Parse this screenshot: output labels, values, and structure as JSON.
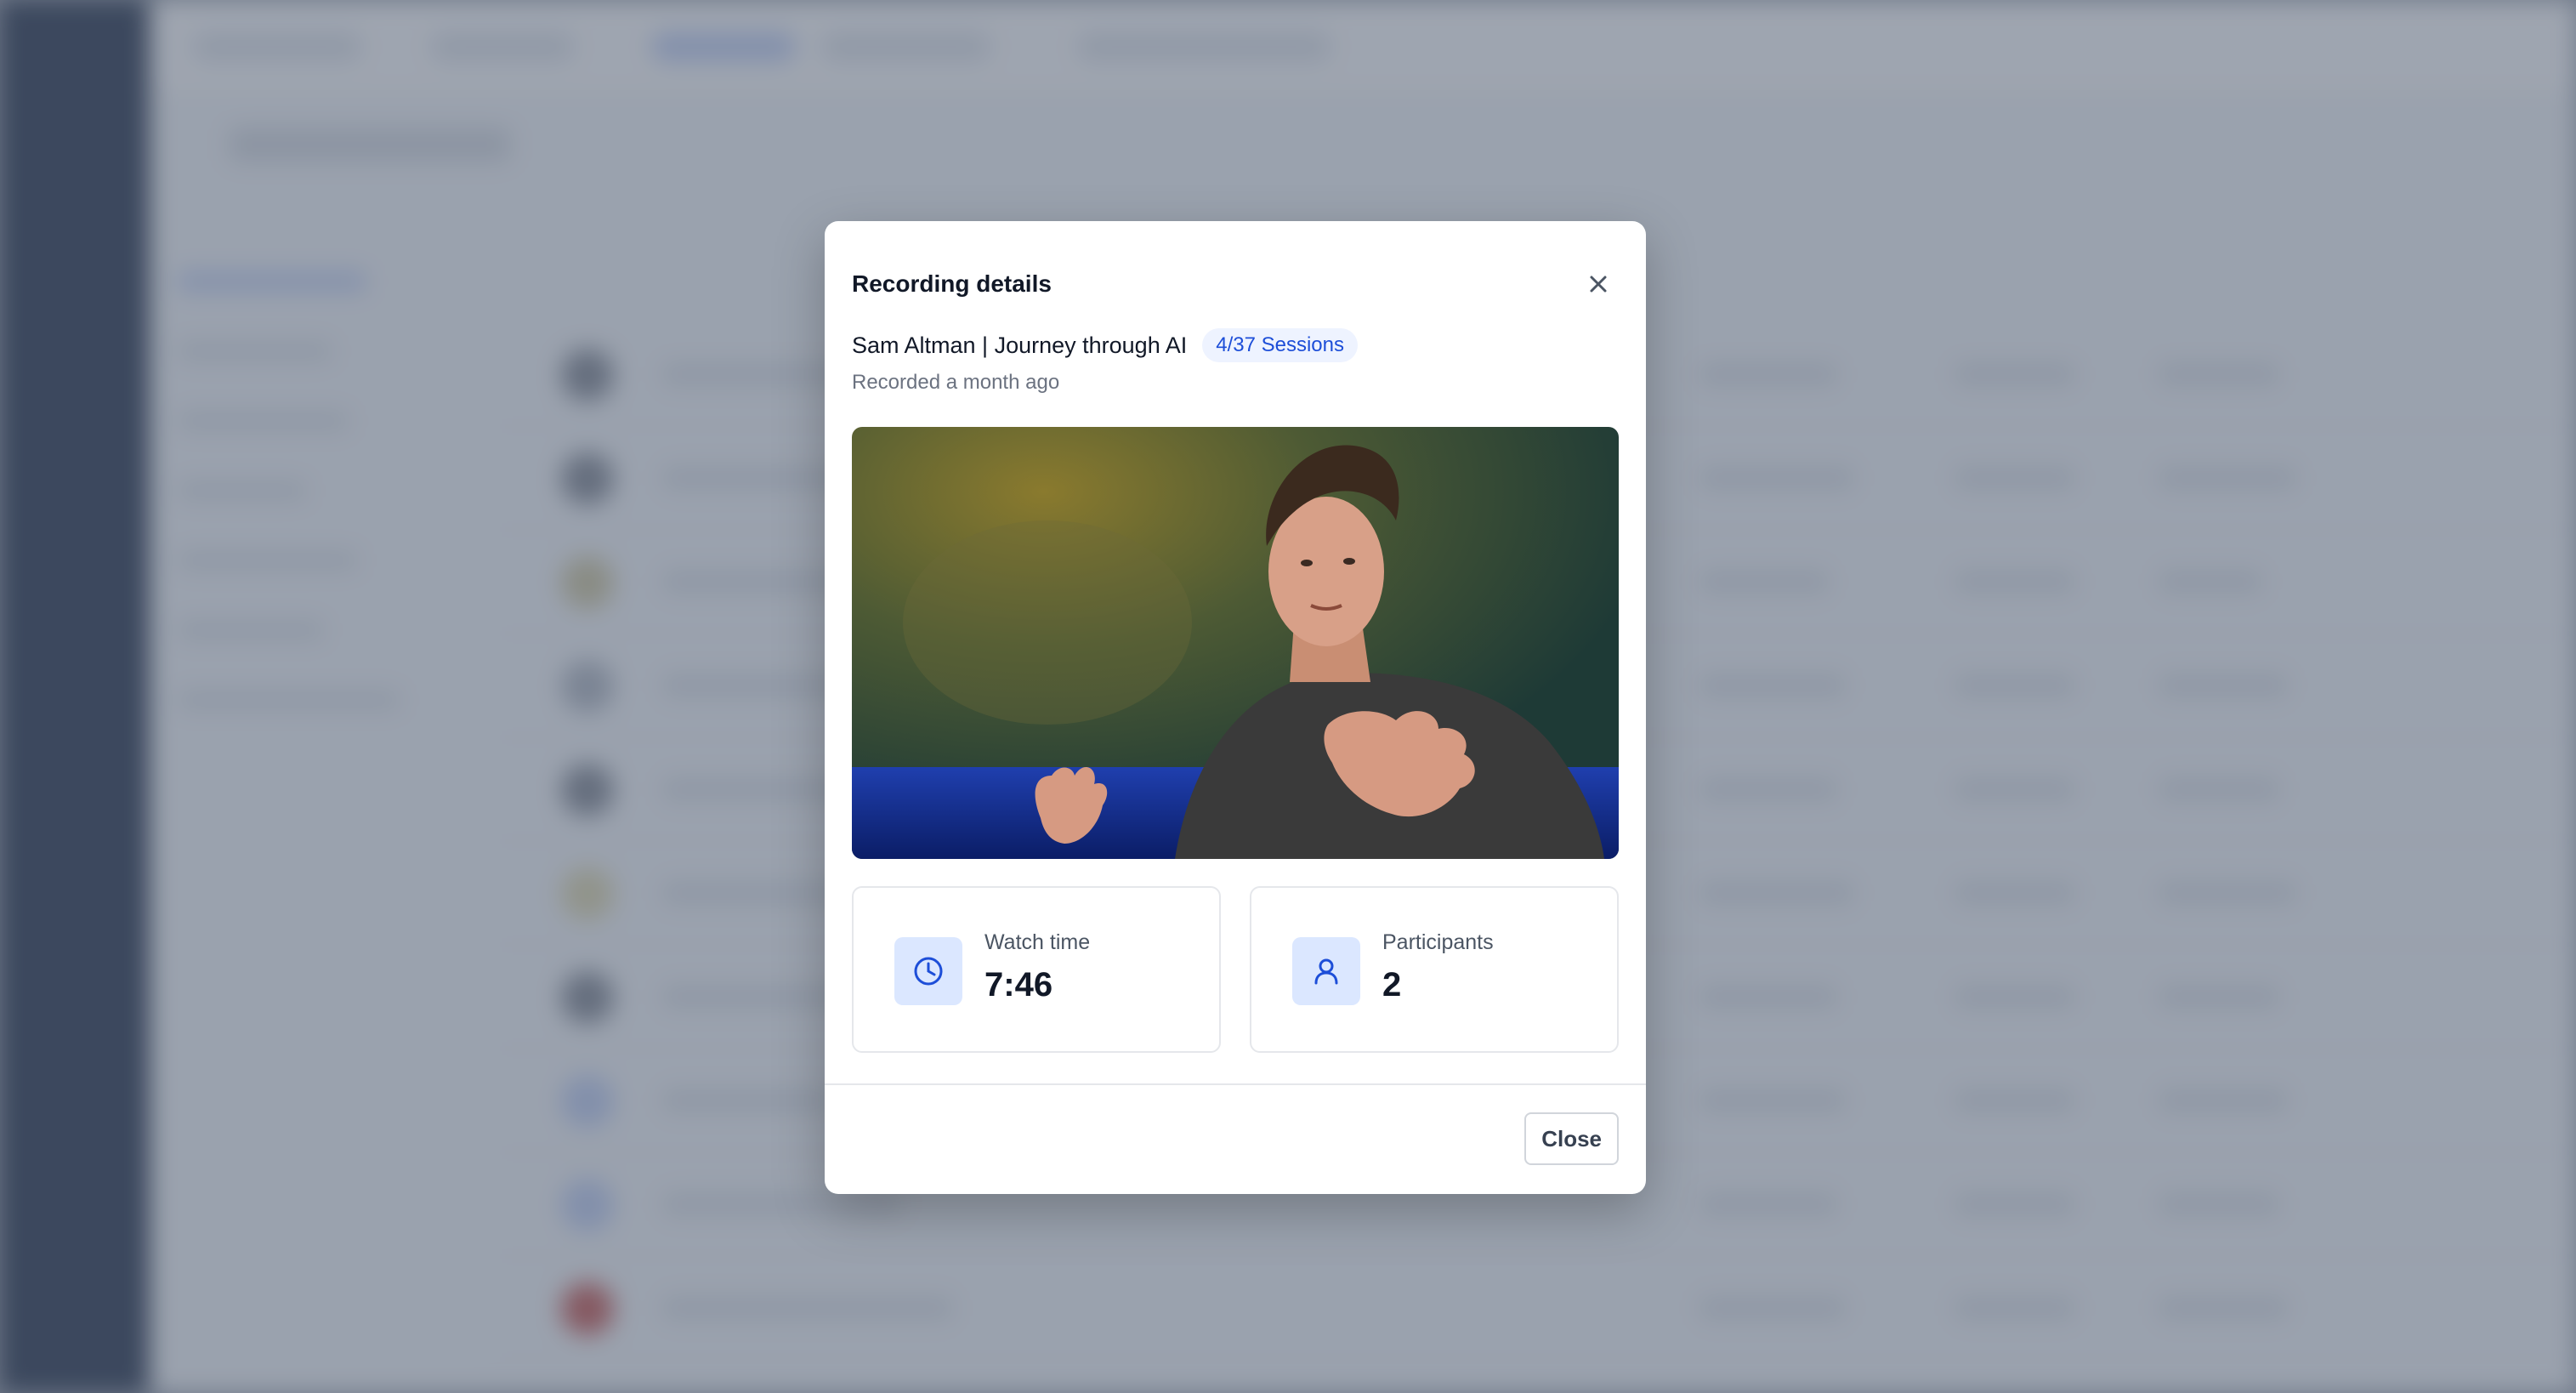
{
  "modal": {
    "title": "Recording details",
    "session_title": "Sam Altman | Journey through AI",
    "session_badge": "4/37 Sessions",
    "recorded_text": "Recorded a month ago",
    "stats": [
      {
        "label": "Watch time",
        "value": "7:46",
        "icon": "clock-icon"
      },
      {
        "label": "Participants",
        "value": "2",
        "icon": "user-icon"
      }
    ],
    "close_label": "Close"
  },
  "colors": {
    "accent": "#1d4ed8",
    "badge_bg": "#eef3ff",
    "icon_bg": "#dbe7ff",
    "overlay": "#566073"
  }
}
